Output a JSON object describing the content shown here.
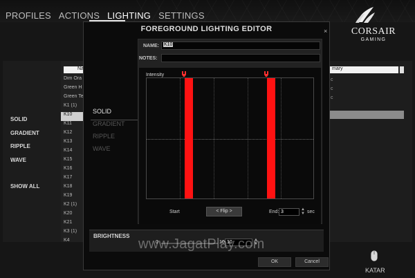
{
  "app": {
    "nav": [
      {
        "label": "PROFILES"
      },
      {
        "label": "ACTIONS"
      },
      {
        "label": "LIGHTING",
        "active": true
      },
      {
        "label": "SETTINGS"
      }
    ],
    "logo": {
      "brand": "CORSAIR",
      "sub": "GAMING"
    }
  },
  "left_menu": {
    "items": [
      "SOLID",
      "GRADIENT",
      "RIPPLE",
      "WAVE"
    ],
    "show_all": "SHOW ALL"
  },
  "key_list": {
    "header": "Na",
    "items": [
      "Dim Ora",
      "Green H",
      "Green Te",
      "K1 (1)",
      "K10",
      "K11",
      "K12",
      "K13",
      "K14",
      "K15",
      "K16",
      "K17",
      "K18",
      "K19",
      "K2 (1)",
      "K20",
      "K21",
      "K3 (1)",
      "K4"
    ],
    "selected_index": 4
  },
  "right_panel": {
    "header": "mary",
    "items": [
      "c",
      "c",
      "c"
    ]
  },
  "device": {
    "label": "KATAR"
  },
  "dialog": {
    "title": "FOREGROUND LIGHTING EDITOR",
    "close_glyph": "×",
    "modes": [
      "SOLID",
      "GRADIENT",
      "RIPPLE",
      "WAVE"
    ],
    "active_mode": 0,
    "name_label": "NAME:",
    "name_value": "K10",
    "notes_label": "NOTES:",
    "notes_value": "",
    "graph": {
      "y_label": "Intensity",
      "bar_color": "#ff1212",
      "start_label": "Start",
      "flip_label": "< Flip >",
      "end_label": "End:",
      "end_value": "3",
      "sec_label": "sec"
    },
    "brightness": {
      "label": "BRIGHTNESS",
      "min": "0",
      "max": "10",
      "value": "10"
    },
    "ok_label": "OK",
    "cancel_label": "Cancel"
  },
  "watermark": "www.JagatPlay.com",
  "colors": {
    "accent_red": "#ff1212",
    "background": "#161616"
  }
}
